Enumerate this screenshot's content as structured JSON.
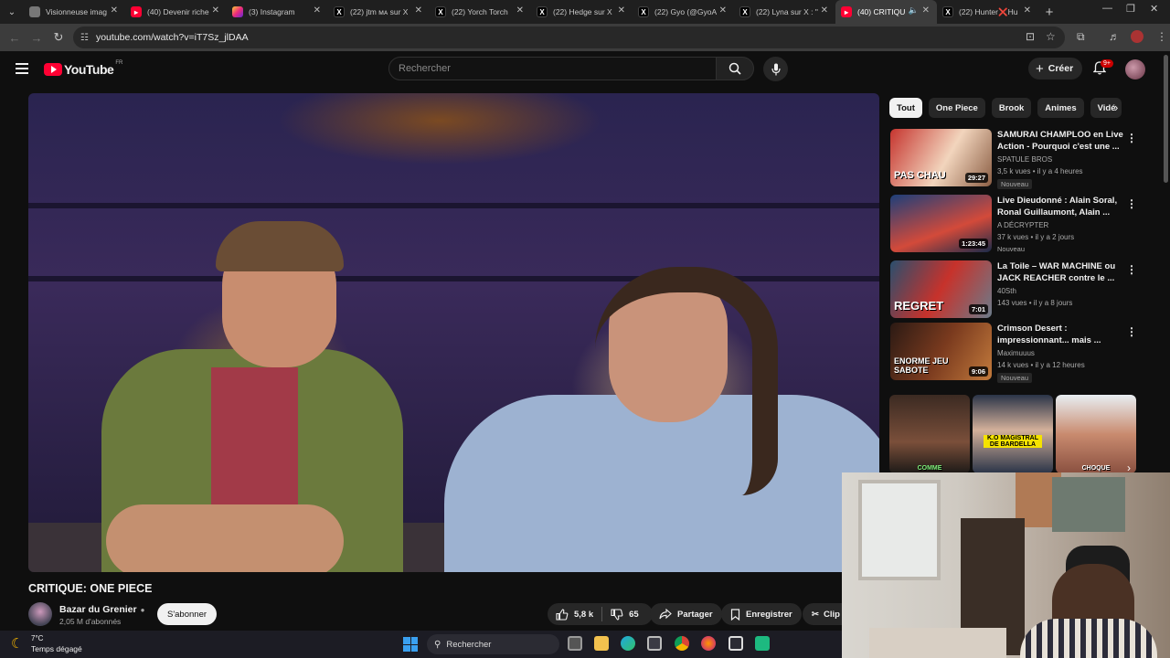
{
  "browser": {
    "tabs": [
      {
        "label": "Visionneuse imag",
        "favicon": "image-icon"
      },
      {
        "label": "(40) Devenir riche",
        "favicon": "youtube-icon"
      },
      {
        "label": "(3) Instagram",
        "favicon": "instagram-icon"
      },
      {
        "label": "(22) jtm ᴍᴀ sur X",
        "favicon": "x-icon"
      },
      {
        "label": "(22) Yorch Torch",
        "favicon": "x-icon"
      },
      {
        "label": "(22) Hedge sur X",
        "favicon": "x-icon"
      },
      {
        "label": "(22) Gyo (@GyoA",
        "favicon": "x-icon"
      },
      {
        "label": "(22) Lyna sur X : \"",
        "favicon": "x-icon"
      },
      {
        "label": "(40) CRITIQUE",
        "favicon": "youtube-icon",
        "active": true
      },
      {
        "label": "(22) Hunter❌Hu",
        "favicon": "x-icon"
      }
    ],
    "url": "youtube.com/watch?v=iT7Sz_jlDAA"
  },
  "youtube": {
    "logo_text": "YouTube",
    "country": "FR",
    "search_placeholder": "Rechercher",
    "create_label": "Créer",
    "notification_count": "9+",
    "brand_color": "#ff0033"
  },
  "video": {
    "title": "CRITIQUE: ONE PIECE",
    "channel": "Bazar du Grenier",
    "subscribers": "2,05 M d'abonnés",
    "subscribe_label": "S'abonner",
    "likes": "5,8 k",
    "dislikes": "65",
    "share_label": "Partager",
    "save_label": "Enregistrer",
    "clip_label": "Clip"
  },
  "sidebar": {
    "chips": [
      "Tout",
      "One Piece",
      "Brook",
      "Animes",
      "Vidé"
    ],
    "recommendations": [
      {
        "title": "SAMURAI CHAMPLOO en Live Action - Pourquoi c'est une ...",
        "channel": "SPATULE BROS",
        "stats": "3,5 k vues • il y a 4 heures",
        "badge": "Nouveau",
        "duration": "29:27",
        "thumb_text": "PAS CHAU"
      },
      {
        "title": "Live Dieudonné : Alain Soral, Ronal Guillaumont, Alain ...",
        "channel": "A DÉCRYPTER",
        "stats": "37 k vues • il y a 2 jours",
        "badge": "",
        "duration": "1:23:45",
        "thumb_text": ""
      },
      {
        "title": "La Toile – WAR MACHINE ou JACK REACHER contre le ...",
        "channel": "40Sth",
        "stats": "143 vues • il y a 8 jours",
        "badge": "",
        "duration": "7:01",
        "thumb_text": "REGRET"
      },
      {
        "title": "Crimson Desert : impressionnant... mais ...",
        "channel": "Maximuuus",
        "stats": "14 k vues • il y a 12 heures",
        "badge": "Nouveau",
        "duration": "9:06",
        "thumb_text": "ENORME JEU SABOTE"
      }
    ],
    "shorts": [
      {
        "caption": "COMME"
      },
      {
        "caption": "K.O MAGISTRAL DE BARDELLA"
      },
      {
        "caption": "CHOQUE"
      }
    ]
  },
  "taskbar": {
    "temperature": "7°C",
    "weather": "Temps dégagé",
    "search_label": "Rechercher"
  }
}
